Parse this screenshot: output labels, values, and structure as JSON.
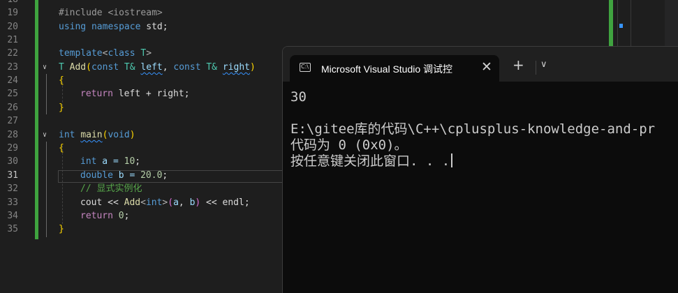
{
  "editor": {
    "line_numbers": [
      "18",
      "19",
      "20",
      "21",
      "22",
      "23",
      "24",
      "25",
      "26",
      "27",
      "28",
      "29",
      "30",
      "31",
      "32",
      "33",
      "34",
      "35"
    ],
    "active_line": "31",
    "code": {
      "l19": {
        "a": "#include ",
        "b": "<iostream>"
      },
      "l20": {
        "a": "using",
        "b": " ",
        "c": "namespace",
        "d": " std;"
      },
      "l22": {
        "a": "template",
        "b": "<",
        "c": "class",
        "d": " T",
        "e": ">"
      },
      "l23": {
        "a": "T",
        "b": " ",
        "c": "Add",
        "d": "(",
        "e": "const",
        "f": " T& ",
        "g": "left",
        "h": ", ",
        "i": "const",
        "j": " T& ",
        "k": "right",
        "l": ")"
      },
      "l24": {
        "a": "{"
      },
      "l25": {
        "a": "return",
        "b": " left + right;"
      },
      "l26": {
        "a": "}"
      },
      "l28": {
        "a": "int",
        "b": " ",
        "c": "main",
        "d": "(",
        "e": "void",
        "f": ")"
      },
      "l29": {
        "a": "{"
      },
      "l30": {
        "a": "int",
        "b": " a = ",
        "c": "10",
        "d": ";"
      },
      "l31": {
        "a": "double",
        "b": " b = ",
        "c": "20.0",
        "d": ";"
      },
      "l32": {
        "a": "// 显式实例化"
      },
      "l33": {
        "a": "cout",
        "b": " << ",
        "c": "Add",
        "d": "<",
        "e": "int",
        "f": ">",
        "g": "(",
        "h": "a",
        "i": ", ",
        "j": "b",
        "k": ")",
        "l": " << ",
        "m": "endl",
        "n": ";"
      },
      "l34": {
        "a": "return",
        "b": " ",
        "c": "0",
        "d": ";"
      },
      "l35": {
        "a": "}"
      }
    },
    "fold_glyph": "∨"
  },
  "console": {
    "tab_icon_text": "C:\\",
    "tab_title": "Microsoft Visual Studio 调试控",
    "close_glyph": "✕",
    "add_glyph": "+",
    "dropdown_glyph": "∨",
    "lines": [
      "30",
      "",
      "E:\\gitee库的代码\\C++\\cplusplus-knowledge-and-pr",
      "代码为 0 (0x0)。",
      "按任意键关闭此窗口. . ."
    ]
  },
  "colors": {
    "keyword": "#569cd6",
    "type": "#4ec9b0",
    "function": "#dcdcaa",
    "variable": "#9cdcfe",
    "number": "#b5cea8",
    "comment": "#57a64a",
    "change_bar": "#3fa33f",
    "console_bg": "#0c0c0c"
  }
}
